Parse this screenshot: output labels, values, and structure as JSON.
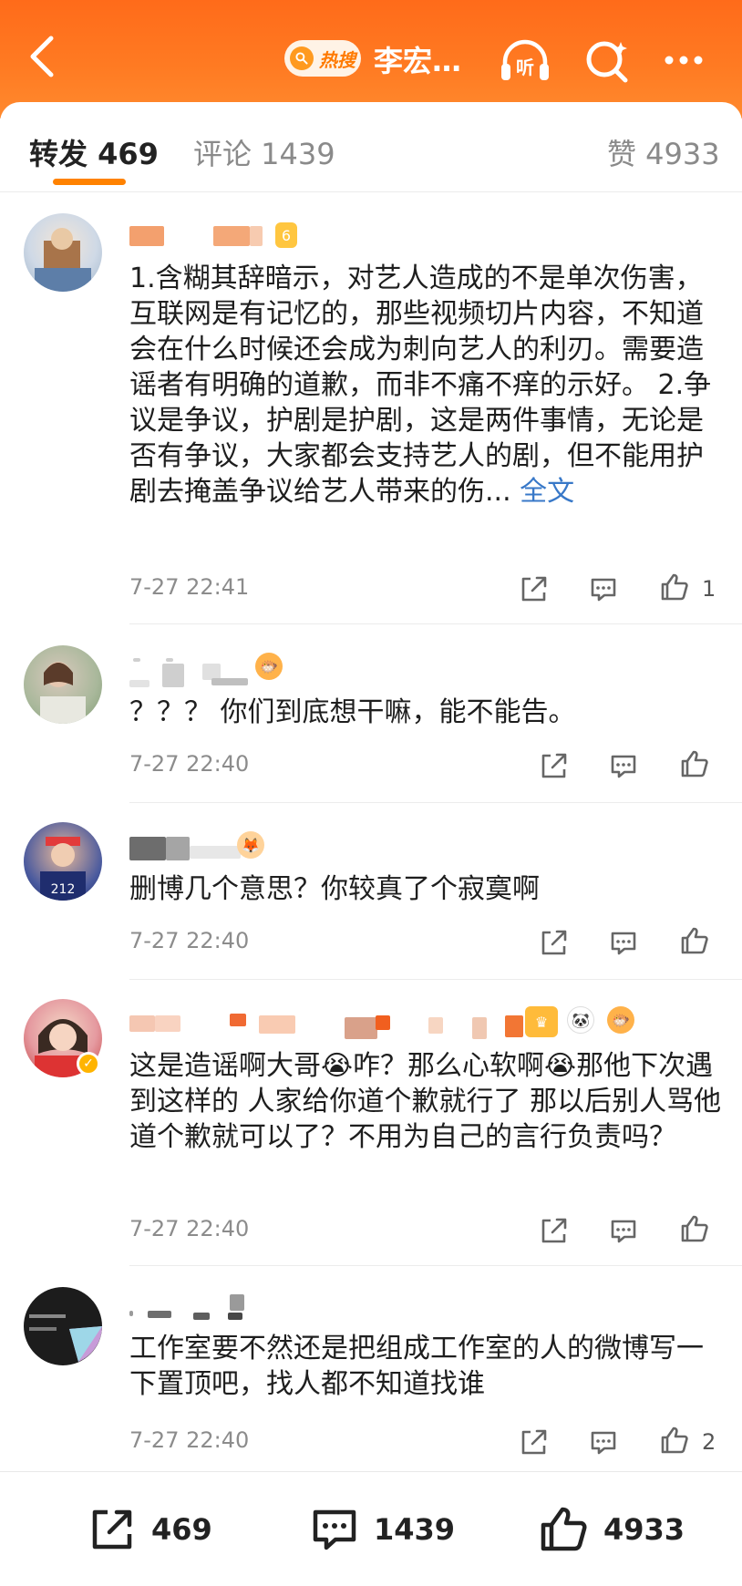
{
  "header": {
    "hot_label": "热搜",
    "title": "李宏…",
    "colors": {
      "bar": "#ff6b1a",
      "accent": "#ff8200"
    },
    "icons": [
      "back-chevron-icon",
      "hot-search-icon",
      "listen-icon",
      "search-icon",
      "more-icon"
    ]
  },
  "tabs": [
    {
      "label": "转发 469",
      "active": true
    },
    {
      "label": "评论 1439",
      "active": false
    },
    {
      "label": "赞 4933",
      "active": false
    }
  ],
  "comments": [
    {
      "text": "1.含糊其辞暗示，对艺人造成的不是单次伤害，互联网是有记忆的，那些视频切片内容，不知道会在什么时候还会成为刺向艺人的利刃。需要造谣者有明确的道歉，而非不痛不痒的示好。 2.争议是争议，护剧是护剧，这是两件事情，无论是否有争议，大家都会支持艺人的剧，但不能用护剧去掩盖争议给艺人带来的伤...",
      "more": " 全文",
      "time": "7-27 22:41",
      "likes": "1"
    },
    {
      "text": "？？？ 你们到底想干嘛，能不能告。",
      "time": "7-27 22:40",
      "likes": ""
    },
    {
      "text": "删博几个意思？你较真了个寂寞啊",
      "time": "7-27 22:40",
      "likes": ""
    },
    {
      "text": "这是造谣啊大哥😭咋？那么心软啊😭那他下次遇到这样的 人家给你道个歉就行了 那以后别人骂他 道个歉就可以了？不用为自己的言行负责吗？",
      "time": "7-27 22:40",
      "likes": ""
    },
    {
      "text": "工作室要不然还是把组成工作室的人的微博写一下置顶吧，找人都不知道找谁",
      "time": "7-27 22:40",
      "likes": "2"
    }
  ],
  "bottom_bar": {
    "repost_count": "469",
    "comment_count": "1439",
    "like_count": "4933"
  }
}
